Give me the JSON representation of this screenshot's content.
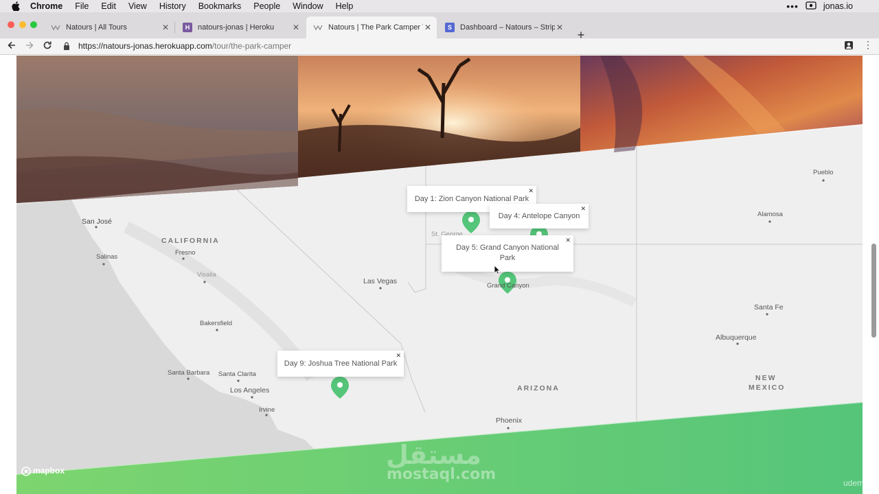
{
  "menubar": {
    "app": "Chrome",
    "items": [
      "File",
      "Edit",
      "View",
      "History",
      "Bookmarks",
      "People",
      "Window",
      "Help"
    ],
    "right_label": "jonas.io"
  },
  "tabs": [
    {
      "title": "Natours | All Tours",
      "favicon": "natours-logo-icon",
      "active": false
    },
    {
      "title": "natours-jonas | Heroku",
      "favicon": "heroku-icon",
      "active": false
    },
    {
      "title": "Natours | The Park Camper Tour",
      "favicon": "natours-logo-icon",
      "active": true
    },
    {
      "title": "Dashboard – Natours – Stripe",
      "favicon": "stripe-icon",
      "active": false
    }
  ],
  "address": {
    "host": "https://natours-jonas.herokuapp.com",
    "path": "/tour/the-park-camper"
  },
  "map": {
    "popups": [
      {
        "label": "Day 1: Zion Canyon National Park"
      },
      {
        "label": "Day 4: Antelope Canyon"
      },
      {
        "label": "Day 5: Grand Canyon National Park"
      },
      {
        "label": "Day 9: Joshua Tree National Park"
      }
    ],
    "cities": [
      "San José",
      "Salinas",
      "Fresno",
      "Visalia",
      "Bakersfield",
      "Santa Barbara",
      "Santa Clarita",
      "Los Angeles",
      "Irvine",
      "Las Vegas",
      "Phoenix",
      "Pueblo",
      "Alamosa",
      "Santa Fe",
      "Albuquerque",
      "Grand Canyon",
      "St. George"
    ],
    "states": [
      "CALIFORNIA",
      "ARIZONA",
      "NEW",
      "MEXICO"
    ],
    "attribution": "mapbox",
    "marker_color": "#55c57a"
  },
  "watermark": {
    "arabic": "مستقل",
    "latin": "mostaql.com",
    "corner": "udemy"
  },
  "colors": {
    "green": "#55c57a",
    "green_light": "#7dd56f"
  }
}
